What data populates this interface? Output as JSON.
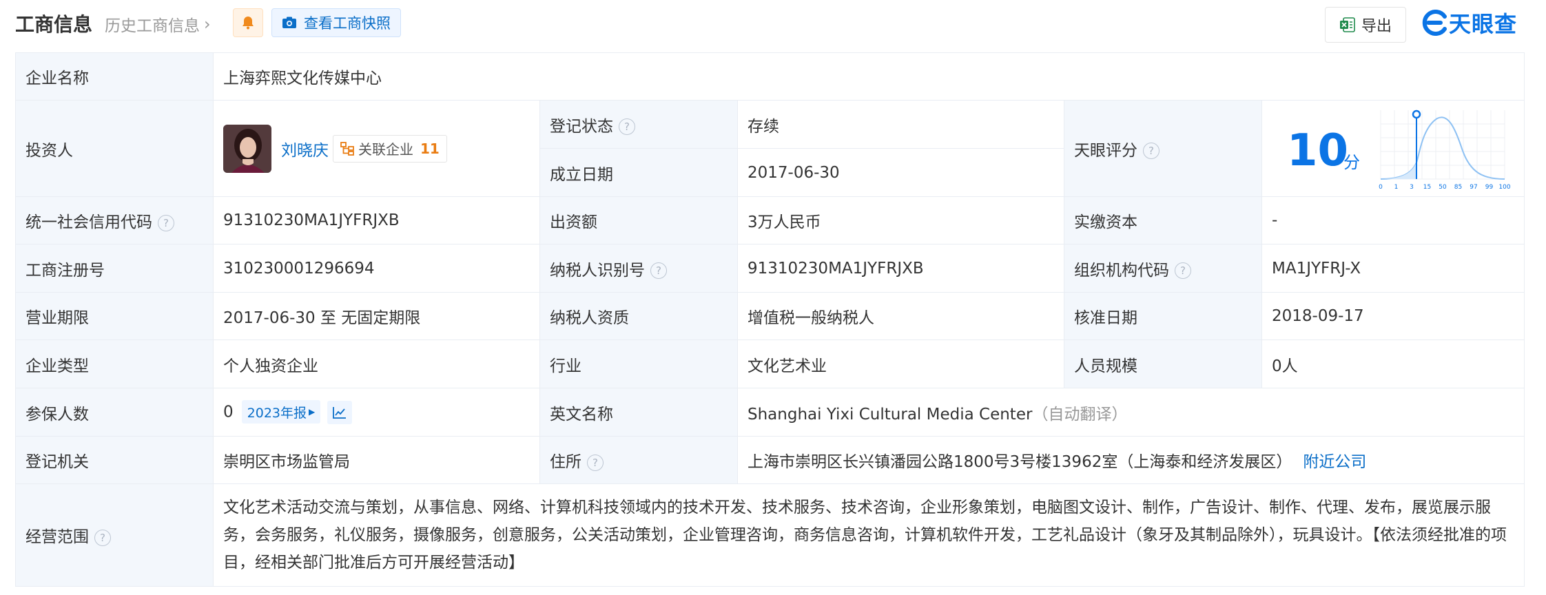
{
  "header": {
    "title": "工商信息",
    "history_label": "历史工商信息",
    "snapshot_label": "查看工商快照",
    "export_label": "导出",
    "logo_text": "天眼查"
  },
  "rows": {
    "company_name": {
      "label": "企业名称",
      "value": "上海弈熙文化传媒中心"
    },
    "investor": {
      "label": "投资人",
      "name": "刘晓庆",
      "related_label": "关联企业",
      "related_count": "11"
    },
    "reg_status": {
      "label": "登记状态",
      "value": "存续"
    },
    "found_date": {
      "label": "成立日期",
      "value": "2017-06-30"
    },
    "score": {
      "label": "天眼评分",
      "value": "10",
      "unit": "分",
      "ticks": [
        "0",
        "1",
        "3",
        "15",
        "50",
        "85",
        "97",
        "99",
        "100"
      ]
    },
    "credit_code": {
      "label": "统一社会信用代码",
      "value": "91310230MA1JYFRJXB"
    },
    "capital": {
      "label": "出资额",
      "value": "3万人民币"
    },
    "paid_capital": {
      "label": "实缴资本",
      "value": "-"
    },
    "reg_no": {
      "label": "工商注册号",
      "value": "310230001296694"
    },
    "tax_id": {
      "label": "纳税人识别号",
      "value": "91310230MA1JYFRJXB"
    },
    "org_code": {
      "label": "组织机构代码",
      "value": "MA1JYFRJ-X"
    },
    "term": {
      "label": "营业期限",
      "value": "2017-06-30 至 无固定期限"
    },
    "tax_qual": {
      "label": "纳税人资质",
      "value": "增值税一般纳税人"
    },
    "approve_date": {
      "label": "核准日期",
      "value": "2018-09-17"
    },
    "company_type": {
      "label": "企业类型",
      "value": "个人独资企业"
    },
    "industry": {
      "label": "行业",
      "value": "文化艺术业"
    },
    "staff_size": {
      "label": "人员规模",
      "value": "0人"
    },
    "insured": {
      "label": "参保人数",
      "value": "0",
      "report_label": "2023年报"
    },
    "en_name": {
      "label": "英文名称",
      "value": "Shanghai Yixi Cultural Media Center",
      "note": "（自动翻译）"
    },
    "authority": {
      "label": "登记机关",
      "value": "崇明区市场监管局"
    },
    "address": {
      "label": "住所",
      "value": "上海市崇明区长兴镇潘园公路1800号3号楼13962室（上海泰和经济发展区）",
      "nearby_label": "附近公司"
    },
    "scope": {
      "label": "经营范围",
      "value": "文化艺术活动交流与策划，从事信息、网络、计算机科技领域内的技术开发、技术服务、技术咨询，企业形象策划，电脑图文设计、制作，广告设计、制作、代理、发布，展览展示服务，会务服务，礼仪服务，摄像服务，创意服务，公关活动策划，企业管理咨询，商务信息咨询，计算机软件开发，工艺礼品设计（象牙及其制品除外），玩具设计。【依法须经批准的项目，经相关部门批准后方可开展经营活动】"
    }
  },
  "colors": {
    "accent": "#0b74e5",
    "status_green": "#1a9b45",
    "label_bg": "#f3f7fc",
    "count_orange": "#e97c12"
  }
}
